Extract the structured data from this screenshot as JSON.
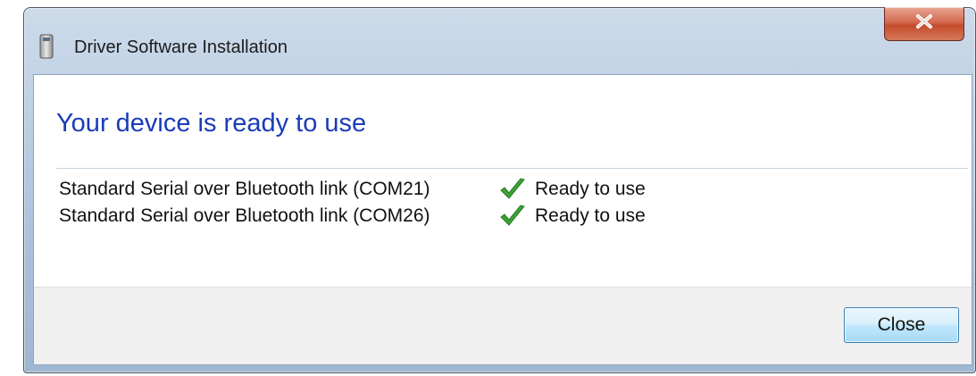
{
  "window": {
    "title": "Driver Software Installation",
    "close_glyph": "X"
  },
  "content": {
    "heading": "Your device is ready to use",
    "devices": [
      {
        "name": "Standard Serial over Bluetooth link (COM21)",
        "status": "Ready to use",
        "status_icon": "green-checkmark-icon"
      },
      {
        "name": "Standard Serial over Bluetooth link (COM26)",
        "status": "Ready to use",
        "status_icon": "green-checkmark-icon"
      }
    ]
  },
  "footer": {
    "close_label": "Close"
  },
  "colors": {
    "heading": "#1a3cb8",
    "check": "#3aa335",
    "close_button_red": "#c24c2c"
  }
}
